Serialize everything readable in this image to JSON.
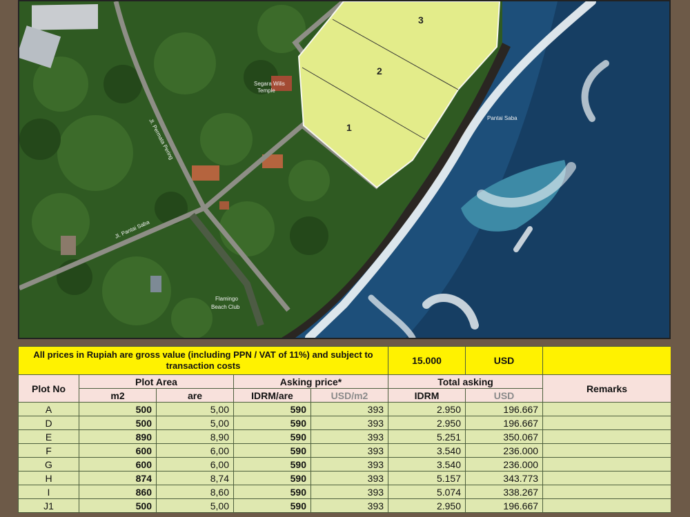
{
  "map": {
    "labels": {
      "temple": [
        "Segara Wilis",
        "Temple"
      ],
      "road_permata": "Jl. Permata Pering",
      "road_pantai": "Jl. Pantai Saba",
      "beach": "Pantai Saba",
      "club": [
        "Flamingo",
        "Beach Club"
      ]
    },
    "plots": [
      "1",
      "2",
      "3"
    ],
    "colors": {
      "plot_fill": "#e3ec8a",
      "sea": "#1d4f7a",
      "jungle": "#2f5a22"
    }
  },
  "table": {
    "note": "All prices in Rupiah are gross value (including PPN / VAT of 11%) and subject to transaction costs",
    "exchange_rate": "15.000",
    "currency": "USD",
    "headers": {
      "plot_no": "Plot No",
      "plot_area": "Plot Area",
      "asking_price": "Asking price*",
      "total_asking": "Total asking",
      "remarks": "Remarks",
      "m2": "m2",
      "are": "are",
      "idrm_are": "IDRM/are",
      "usd_m2": "USD/m2",
      "idrm": "IDRM",
      "usd": "USD"
    },
    "rows": [
      {
        "plot": "A",
        "m2": "500",
        "are": "5,00",
        "idrm_are": "590",
        "usd_m2": "393",
        "idrm": "2.950",
        "usd": "196.667",
        "remarks": ""
      },
      {
        "plot": "D",
        "m2": "500",
        "are": "5,00",
        "idrm_are": "590",
        "usd_m2": "393",
        "idrm": "2.950",
        "usd": "196.667",
        "remarks": ""
      },
      {
        "plot": "E",
        "m2": "890",
        "are": "8,90",
        "idrm_are": "590",
        "usd_m2": "393",
        "idrm": "5.251",
        "usd": "350.067",
        "remarks": ""
      },
      {
        "plot": "F",
        "m2": "600",
        "are": "6,00",
        "idrm_are": "590",
        "usd_m2": "393",
        "idrm": "3.540",
        "usd": "236.000",
        "remarks": ""
      },
      {
        "plot": "G",
        "m2": "600",
        "are": "6,00",
        "idrm_are": "590",
        "usd_m2": "393",
        "idrm": "3.540",
        "usd": "236.000",
        "remarks": ""
      },
      {
        "plot": "H",
        "m2": "874",
        "are": "8,74",
        "idrm_are": "590",
        "usd_m2": "393",
        "idrm": "5.157",
        "usd": "343.773",
        "remarks": ""
      },
      {
        "plot": "I",
        "m2": "860",
        "are": "8,60",
        "idrm_are": "590",
        "usd_m2": "393",
        "idrm": "5.074",
        "usd": "338.267",
        "remarks": ""
      },
      {
        "plot": "J1",
        "m2": "500",
        "are": "5,00",
        "idrm_are": "590",
        "usd_m2": "393",
        "idrm": "2.950",
        "usd": "196.667",
        "remarks": ""
      }
    ]
  }
}
